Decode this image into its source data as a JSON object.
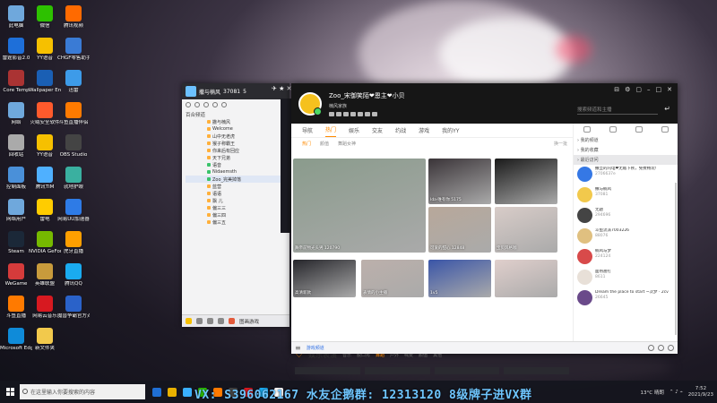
{
  "desktop": {
    "icons": [
      {
        "label": "此电脑",
        "color": "#6fa8dc"
      },
      {
        "label": "微信",
        "color": "#2dc100"
      },
      {
        "label": "腾讯视频",
        "color": "#ff6a00"
      },
      {
        "label": "雷霆影音2.0",
        "color": "#1e6fd9"
      },
      {
        "label": "YY语音",
        "color": "#f6c000"
      },
      {
        "label": "CHGF零售助手",
        "color": "#3a7bd5"
      },
      {
        "label": "Core Temp",
        "color": "#aa3333"
      },
      {
        "label": "Wallpaper Engine",
        "color": "#1a5fb4"
      },
      {
        "label": "迅雷",
        "color": "#3d9be9"
      },
      {
        "label": "网络",
        "color": "#6fa8dc"
      },
      {
        "label": "火绒安全软件",
        "color": "#ff5a2c"
      },
      {
        "label": "斗鱼直播伴侣",
        "color": "#ff7a00"
      },
      {
        "label": "回收站",
        "color": "#aaaaaa"
      },
      {
        "label": "YY语音",
        "color": "#f6c000"
      },
      {
        "label": "OBS Studio",
        "color": "#444444"
      },
      {
        "label": "控制面板",
        "color": "#4a90d9"
      },
      {
        "label": "腾讯TIM",
        "color": "#4fb0ff"
      },
      {
        "label": "就地护眼",
        "color": "#3ab0a0"
      },
      {
        "label": "网络用户",
        "color": "#6fa8dc"
      },
      {
        "label": "雷电",
        "color": "#ffcc00"
      },
      {
        "label": "网易UU加速器",
        "color": "#2e7be6"
      },
      {
        "label": "Steam",
        "color": "#1b2838"
      },
      {
        "label": "NVIDIA GeForce Experience",
        "color": "#76b900"
      },
      {
        "label": "虎牙直播",
        "color": "#ff9f00"
      },
      {
        "label": "WeGame",
        "color": "#d53b3b"
      },
      {
        "label": "英雄联盟",
        "color": "#c89b3c"
      },
      {
        "label": "腾讯QQ",
        "color": "#1aabf0"
      },
      {
        "label": "斗鱼直播",
        "color": "#ff7a00"
      },
      {
        "label": "网易云音乐",
        "color": "#d71920"
      },
      {
        "label": "魔兽争霸官方对战平台",
        "color": "#2a62c9"
      },
      {
        "label": "Microsoft Edge",
        "color": "#0f8bd9"
      },
      {
        "label": "新文件夹",
        "color": "#f2c94c"
      }
    ]
  },
  "chat_panel": {
    "channel_name": "撒与楠风",
    "channel_id": "37081",
    "members": "5",
    "section_label": "百合频道",
    "rows": [
      "撒与楠风",
      "Welcome",
      "山中无老虎",
      "猴子称霸王",
      "你来后有回应",
      "天下兄弟",
      "语音",
      "Nidaemsth",
      "Zoo_完美掉落",
      "蓝营",
      "语语",
      "飘 儿",
      "偏三三",
      "偏三四",
      "偏三五"
    ],
    "bottom_label": "图画游戏"
  },
  "main_window": {
    "user_name": "Zoo_宋御笑陌❤恩主❤小贝",
    "user_sub": "楠风家族",
    "search_placeholder": "搜索频道和主播",
    "controls": [
      "⊟",
      "⚙",
      "▢",
      "–",
      "□",
      "✕"
    ],
    "nav_tabs": [
      "导航",
      "热门",
      "娱乐",
      "交友",
      "约战",
      "游戏",
      "我的YY"
    ],
    "active_nav": "热门",
    "sub_tabs": [
      "热门",
      "颜值",
      "舞蹈女神"
    ],
    "refresh_label": "换一批",
    "cards": [
      {
        "caption": "舞帝前物光头男",
        "count": "120790",
        "color": "#8a9b8c"
      },
      {
        "caption": "Ida·唯有你",
        "count": "5175",
        "color": "#3a3438"
      },
      {
        "caption": "",
        "count": "40106",
        "color": "#1a1a1a"
      },
      {
        "caption": "可爱的甜心",
        "count": "12848",
        "color": "#b8a89a"
      },
      {
        "caption": "宝贝风格咖",
        "count": "",
        "color": "#d8ccc8"
      },
      {
        "caption": "高清新款",
        "count": "",
        "color": "#26262b"
      },
      {
        "caption": "表情的小主播",
        "count": "",
        "color": "#bcb0ab"
      },
      {
        "caption": "1v5",
        "count": "",
        "color": "#3a55a8"
      },
      {
        "caption": "",
        "count": "",
        "color": "#e0cfcc"
      }
    ],
    "section_label": "娱乐表演",
    "section_cats": [
      "音乐",
      "脱口秀",
      "舞蹈",
      "户外",
      "喊麦",
      "颜值",
      "其他"
    ],
    "active_cat": "舞蹈",
    "footer_label": "游戏频道",
    "side_menu": [
      "我的频道",
      "我的收藏",
      "最近访问"
    ],
    "side_highlight": "最近访问",
    "side_items": [
      {
        "title": "撒旦的闪电❤无敌下秋，免费畅玩!",
        "meta": "2706637e",
        "color": "#3578e5"
      },
      {
        "title": "撒与楠风",
        "meta": "37081",
        "color": "#f2c94c"
      },
      {
        "title": "无题",
        "meta": "294696",
        "color": "#444"
      },
      {
        "title": "斗鱼流派7003226",
        "meta": "88076",
        "color": "#e0c080"
      },
      {
        "title": "楠风与梦",
        "meta": "224124",
        "color": "#d84a4a"
      },
      {
        "title": "面熟蔷打",
        "meta": "8611",
        "color": "#e8e0d8"
      },
      {
        "title": "Dream the place to start ~次梦 · 2cv",
        "meta": "26645",
        "color": "#6a4a8a"
      }
    ]
  },
  "taskbar": {
    "search_placeholder": "在这里输入你要搜索的内容",
    "promo_text": "VX: S396062167 水友企鹅群: 12313120  8级牌子进VX群",
    "weather": "13°C 晴朗",
    "time": "7:52",
    "date": "2021/9/23",
    "app_colors": [
      "#1f6fd4",
      "#e8b100",
      "#3ab0ff",
      "#2dc100",
      "#ff7a00",
      "#444",
      "#d71920",
      "#1aabf0",
      "#ffffff"
    ]
  }
}
